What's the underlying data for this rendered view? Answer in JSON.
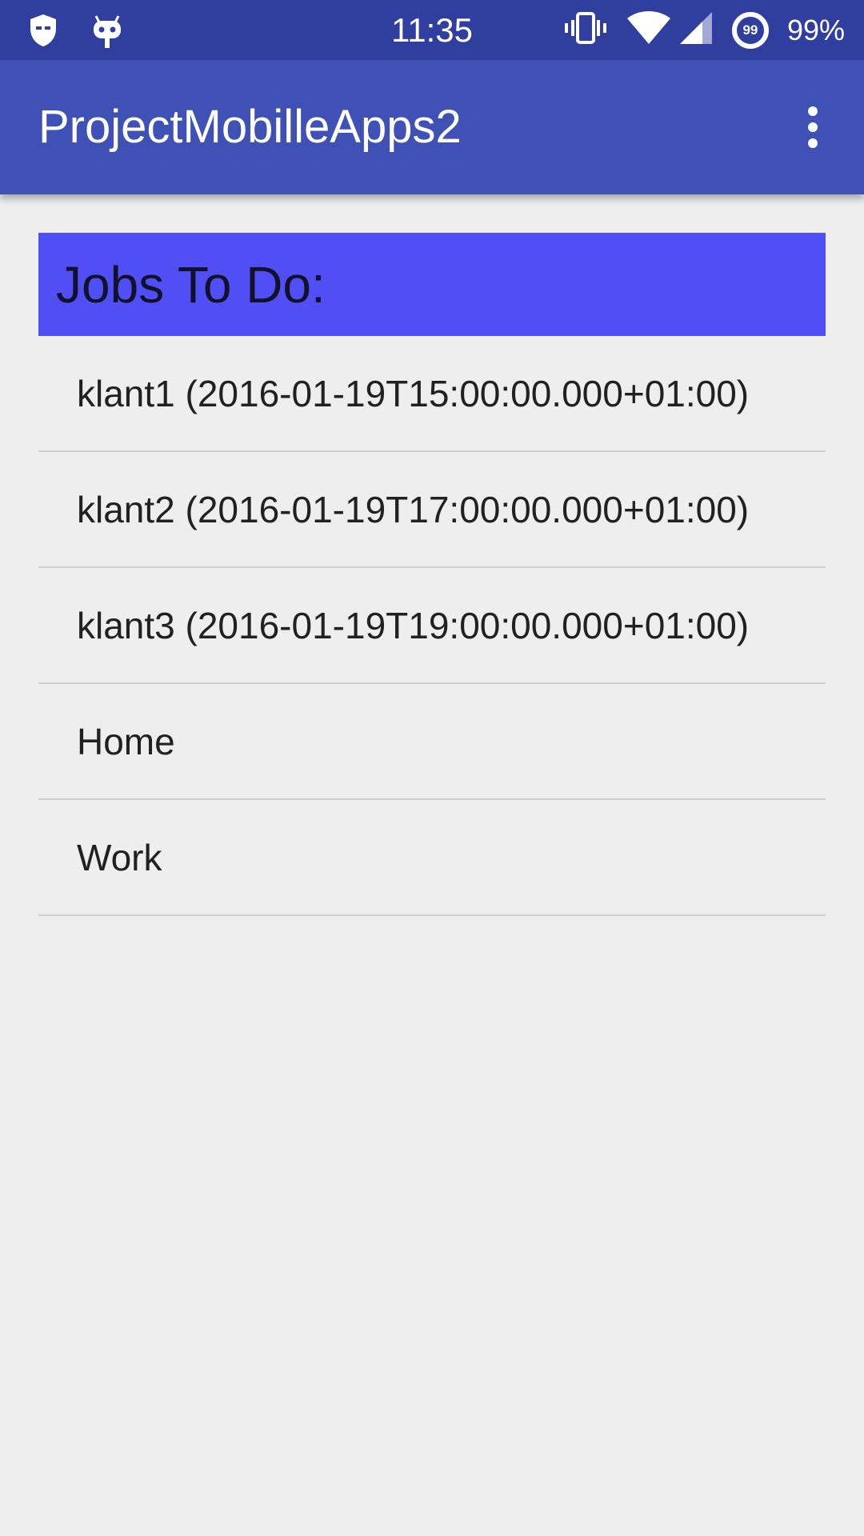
{
  "status_bar": {
    "time": "11:35",
    "battery": "99%",
    "notification_badge": "99",
    "icons": [
      "shield-icon",
      "cyanogen-bot-icon",
      "vibrate-icon",
      "wifi-icon",
      "cell-signal-icon",
      "battery-ring-icon"
    ]
  },
  "app_bar": {
    "title": "ProjectMobilleApps2",
    "menu_icon": "more-vert-icon"
  },
  "main": {
    "header": "Jobs To Do:",
    "items": [
      {
        "label": "klant1 (2016-01-19T15:00:00.000+01:00)"
      },
      {
        "label": "klant2 (2016-01-19T17:00:00.000+01:00)"
      },
      {
        "label": "klant3 (2016-01-19T19:00:00.000+01:00)"
      },
      {
        "label": "Home"
      },
      {
        "label": "Work"
      }
    ]
  },
  "colors": {
    "status_bar": "#303f9f",
    "app_bar": "#3f51b5",
    "header_banner": "#4f4ff5",
    "background": "#eeeeee"
  }
}
